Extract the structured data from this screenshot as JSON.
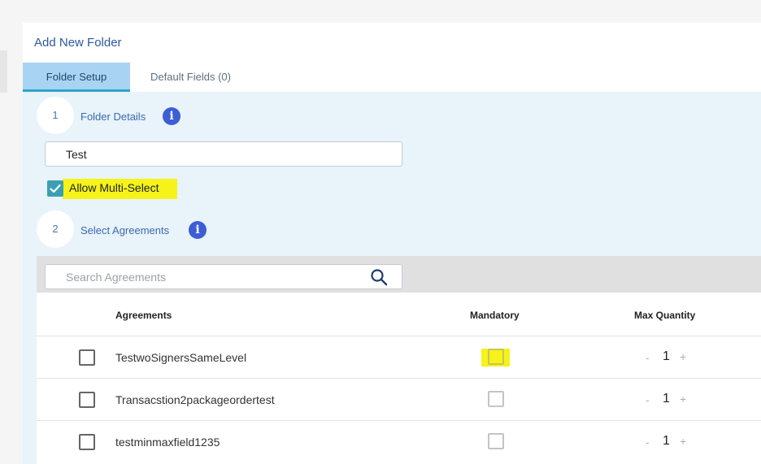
{
  "panel": {
    "title": "Add New Folder"
  },
  "tabs": [
    {
      "label": "Folder Setup",
      "active": true
    },
    {
      "label": "Default Fields (0)",
      "active": false
    }
  ],
  "step1": {
    "number": "1",
    "label": "Folder Details"
  },
  "folder_name": {
    "value": "Test"
  },
  "multi_select": {
    "label": "Allow Multi-Select",
    "checked": true
  },
  "step2": {
    "number": "2",
    "label": "Select Agreements"
  },
  "search": {
    "placeholder": "Search Agreements"
  },
  "table": {
    "headers": {
      "agreements": "Agreements",
      "mandatory": "Mandatory",
      "max_quantity": "Max Quantity"
    },
    "rows": [
      {
        "name": "TestwoSignersSameLevel",
        "selected": false,
        "mandatory": false,
        "qty": "1"
      },
      {
        "name": "Transacstion2packageordertest",
        "selected": false,
        "mandatory": false,
        "qty": "1"
      },
      {
        "name": "testminmaxfield1235",
        "selected": false,
        "mandatory": false,
        "qty": "1"
      }
    ],
    "qty_minus": "-",
    "qty_plus": "+"
  },
  "info_glyph": "i",
  "colors": {
    "accent": "#2ba6c6",
    "info": "#3d5dd4",
    "highlight": "#f5f31a",
    "tab_active": "#a9d3f3"
  }
}
